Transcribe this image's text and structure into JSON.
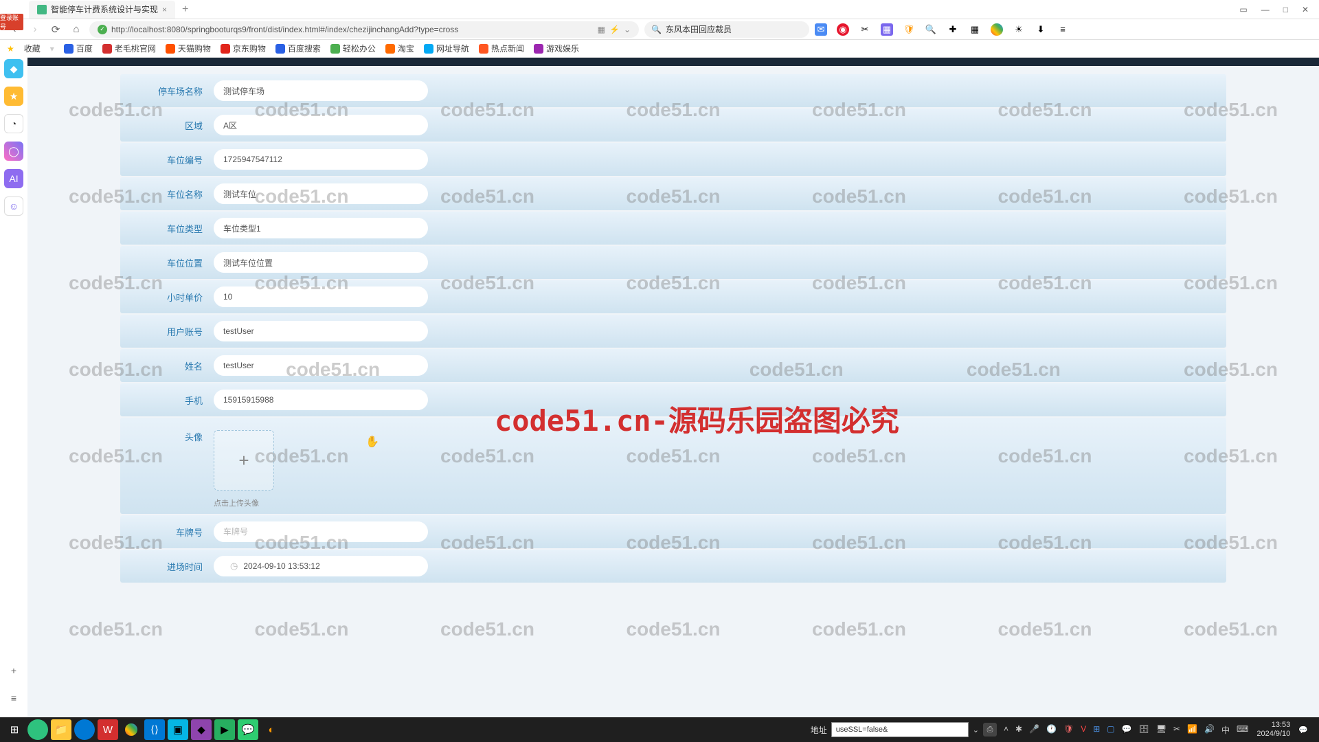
{
  "browser": {
    "tab_title": "智能停车计费系统设计与实现",
    "url": "http://localhost:8080/springbooturqs9/front/dist/index.html#/index/chezijinchangAdd?type=cross",
    "search_value": "东风本田回应裁员"
  },
  "bookmarks": {
    "fav": "收藏",
    "items": [
      "百度",
      "老毛桃官网",
      "天猫购物",
      "京东购物",
      "百度搜索",
      "轻松办公",
      "淘宝",
      "网址导航",
      "热点新闻",
      "游戏娱乐"
    ]
  },
  "watermark": {
    "text": "code51.cn",
    "red_text": "code51.cn-源码乐园盗图必究"
  },
  "form": {
    "parking_name": {
      "label": "停车场名称",
      "value": "测试停车场"
    },
    "area": {
      "label": "区域",
      "value": "A区"
    },
    "spot_no": {
      "label": "车位编号",
      "value": "1725947547112"
    },
    "spot_name": {
      "label": "车位名称",
      "value": "测试车位"
    },
    "spot_type": {
      "label": "车位类型",
      "value": "车位类型1"
    },
    "spot_pos": {
      "label": "车位位置",
      "value": "测试车位位置"
    },
    "hour_price": {
      "label": "小时单价",
      "value": "10"
    },
    "user_acc": {
      "label": "用户账号",
      "value": "testUser"
    },
    "name": {
      "label": "姓名",
      "value": "testUser"
    },
    "phone": {
      "label": "手机",
      "value": "15915915988"
    },
    "avatar": {
      "label": "头像",
      "hint": "点击上传头像"
    },
    "plate": {
      "label": "车牌号",
      "placeholder": "车牌号"
    },
    "enter_time": {
      "label": "进场时间",
      "value": "2024-09-10 13:53:12"
    }
  },
  "taskbar": {
    "addr_label": "地址",
    "select_value": "useSSL=false&",
    "time": "13:53",
    "date": "2024/9/10"
  },
  "badge": "登录账号"
}
